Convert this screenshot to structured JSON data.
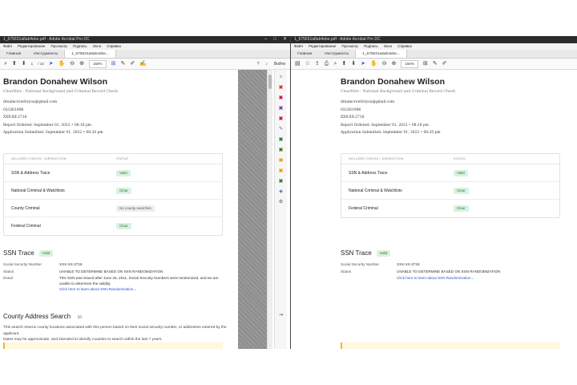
{
  "left_window": {
    "title": "1_675631a8ab4ebe.pdf - Adobe Acrobat Pro DC",
    "menu": [
      "Файл",
      "Редактирование",
      "Просмотр",
      "Подпись",
      "Окно",
      "Справка"
    ],
    "tabs": [
      "Главная",
      "Инструменты",
      "1_675631a8ab4ebe..."
    ],
    "page_current": "1",
    "page_total": "/ 10",
    "zoom": "150%",
    "share_label": "Войти"
  },
  "right_window": {
    "title": "1_675631a8ab4ebe.pdf - Adobe Acrobat Pro DC",
    "menu": [
      "Файл",
      "Редактирование",
      "Просмотр",
      "Подпись",
      "Окно",
      "Справка"
    ],
    "tabs": [
      "Главная",
      "Инструменты",
      "1_675631a8ab4ebe..."
    ],
    "zoom": "150%"
  },
  "report": {
    "name": "Brandon Donahew Wilson",
    "subtitle": "ClearHire - National Background and Criminal Record Check",
    "email": "dreamcrowforyou@gmail.com",
    "dob": "03/28/1996",
    "ssn_masked": "XXX-XX-2718",
    "ordered": "Report Ordered:  September 01, 2022 • 08:18 pm",
    "submitted": "Application Submitted:  September 01, 2022 • 08:20 pm",
    "checks_header": {
      "col1": "INCLUDED CHECKS / JURISDICTION",
      "col2": "STATUS"
    },
    "checks": [
      {
        "name": "SSN & Address Trace",
        "status": "Valid"
      },
      {
        "name": "National Criminal & Watchlists",
        "status": "Clear"
      },
      {
        "name": "County Criminal",
        "status": "No county searches"
      },
      {
        "name": "Federal Criminal",
        "status": "Clear"
      }
    ],
    "checks_right": [
      {
        "name": "SSN & Address Trace",
        "status": "Valid"
      },
      {
        "name": "National Criminal & Watchlists",
        "status": "Clear"
      },
      {
        "name": "Federal Criminal",
        "status": "Clear"
      }
    ],
    "ssn_trace": {
      "title": "SSN Trace",
      "badge": "Valid",
      "ssn_label": "Social Security Number",
      "ssn_value": "XXX-XX-2718",
      "status_label": "Status",
      "status_value": "UNABLE TO DETERMINE BASED ON SSN RANDOMIZATION",
      "detail_label": "Detail",
      "detail_value": "This SSN was issued after June 25, 2011, Social Security Numbers were randomized, and we are unable to determine the validity.",
      "link": "Click here to learn about SSN Randomization→"
    },
    "county": {
      "title": "County Address Search",
      "count": "10",
      "text": "This search returns county locations associated with this person based on their social security number, or addresses entered by the applicant.",
      "text2": "Dates may be approximate, and intended to identify counties to search within the last 7 years."
    }
  }
}
